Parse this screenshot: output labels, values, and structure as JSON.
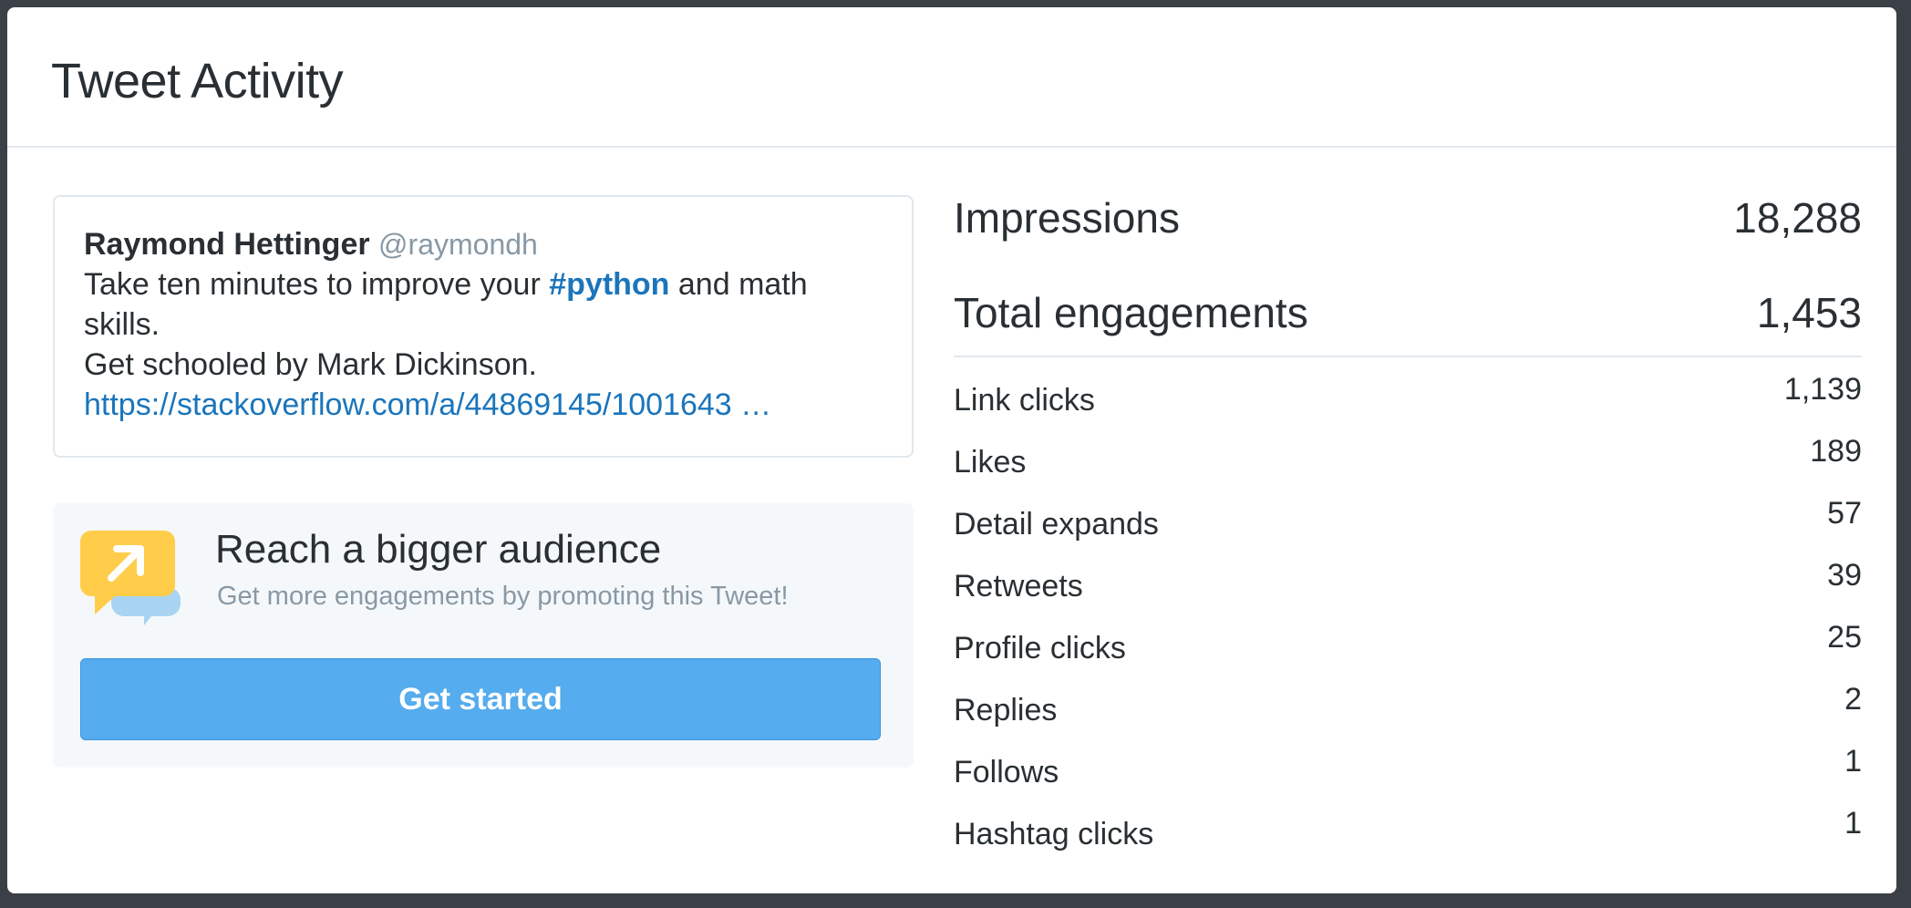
{
  "modal": {
    "title": "Tweet Activity"
  },
  "tweet": {
    "author": "Raymond Hettinger",
    "handle": "@raymondh",
    "text_before_hashtag": "Take ten minutes to improve your ",
    "hashtag": "#python",
    "text_after_hashtag": " and math skills.",
    "line2": "Get schooled by Mark Dickinson.",
    "link": "https://stackoverflow.com/a/44869145/1001643 …"
  },
  "promo": {
    "title": "Reach a bigger audience",
    "subtitle": "Get more engagements by promoting this Tweet!",
    "button_label": "Get started",
    "icon": "promote-arrow-icon",
    "button_color": "#55acee"
  },
  "stats": {
    "impressions_label": "Impressions",
    "impressions_value": "18,288",
    "engagements_label": "Total engagements",
    "engagements_value": "1,453",
    "metrics": [
      {
        "label": "Link clicks",
        "value": "1,139"
      },
      {
        "label": "Likes",
        "value": "189"
      },
      {
        "label": "Detail expands",
        "value": "57"
      },
      {
        "label": "Retweets",
        "value": "39"
      },
      {
        "label": "Profile clicks",
        "value": "25"
      },
      {
        "label": "Replies",
        "value": "2"
      },
      {
        "label": "Follows",
        "value": "1"
      },
      {
        "label": "Hashtag clicks",
        "value": "1"
      }
    ]
  }
}
